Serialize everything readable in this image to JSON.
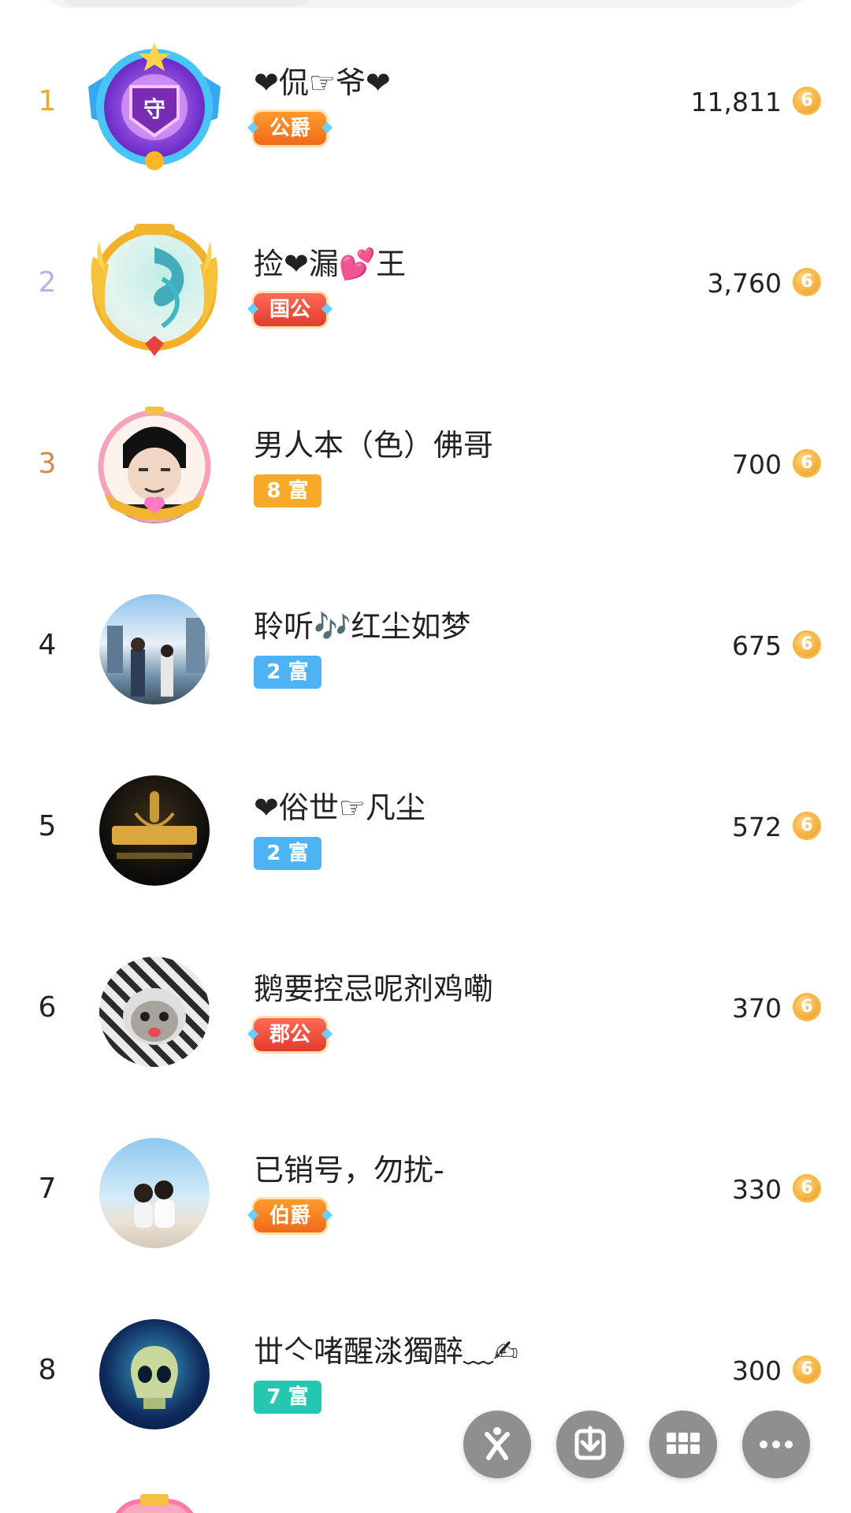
{
  "colors": {
    "rank_gold": "#f2a81d",
    "rank_silver": "#b5b3e6",
    "rank_bronze": "#d08a4e",
    "rank_default": "#222222",
    "fab_gray": "#8f8f8f"
  },
  "rows": [
    {
      "rank": "1",
      "name": "❤侃☞爷❤",
      "badge": "公爵",
      "badge_style": "noble-orange",
      "score": "11,811",
      "coin_icon": "coin-icon",
      "avatar": "shield-guard-avatar"
    },
    {
      "rank": "2",
      "name": "捡❤漏💕王",
      "badge": "国公",
      "badge_style": "noble-red",
      "score": "3,760",
      "coin_icon": "coin-icon",
      "avatar": "dragon-laurel-avatar"
    },
    {
      "rank": "3",
      "name": "男人本（色）佛哥",
      "badge": "8 富",
      "badge_style": "wealth-orange",
      "score": "700",
      "coin_icon": "coin-icon",
      "avatar": "meme-face-avatar"
    },
    {
      "rank": "4",
      "name": "聆听🎶红尘如梦",
      "badge": "2 富",
      "badge_style": "wealth-blue",
      "score": "675",
      "coin_icon": "coin-icon",
      "avatar": "anime-street-avatar"
    },
    {
      "rank": "5",
      "name": "❤俗世☞凡尘",
      "badge": "2 富",
      "badge_style": "wealth-blue",
      "score": "572",
      "coin_icon": "coin-icon",
      "avatar": "microphone-logo-avatar"
    },
    {
      "rank": "6",
      "name": "鹅要控忌呢剂鸡嘞",
      "badge": "郡公",
      "badge_style": "noble-red",
      "score": "370",
      "coin_icon": "coin-icon",
      "avatar": "cat-hoodie-avatar"
    },
    {
      "rank": "7",
      "name": "已销号，勿扰-",
      "badge": "伯爵",
      "badge_style": "noble-orange",
      "score": "330",
      "coin_icon": "coin-icon",
      "avatar": "beach-couple-avatar"
    },
    {
      "rank": "8",
      "name": "丗亽啫醒渁獨醉﹏✍",
      "badge": "7 富",
      "badge_style": "wealth-teal",
      "score": "300",
      "coin_icon": "coin-icon",
      "avatar": "skull-avatar"
    }
  ],
  "fab": [
    {
      "name": "share-icon"
    },
    {
      "name": "download-icon"
    },
    {
      "name": "grid-icon"
    },
    {
      "name": "more-icon"
    }
  ]
}
